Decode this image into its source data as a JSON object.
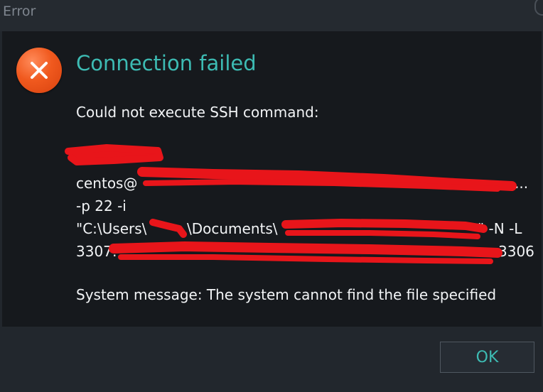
{
  "window": {
    "title": "Error"
  },
  "dialog": {
    "heading": "Connection failed",
    "message": "Could not execute SSH command:",
    "command_lines": [
      "",
      "centos@",
      "-p 22 -i",
      "\"C:\\Users\\",
      "3307:"
    ],
    "command_fragments": {
      "line3_mid": "\\Documents\\",
      "line3_end": "\" -N -L",
      "line2_end": "...",
      "line4_end": "3306"
    },
    "system_message": "System message: The system cannot find the file specified"
  },
  "buttons": {
    "ok_label": "OK"
  },
  "icons": {
    "error": "error-x-icon"
  },
  "colors": {
    "accent": "#3dbbb3",
    "error": "#f0591e",
    "redaction": "#e8151a"
  }
}
